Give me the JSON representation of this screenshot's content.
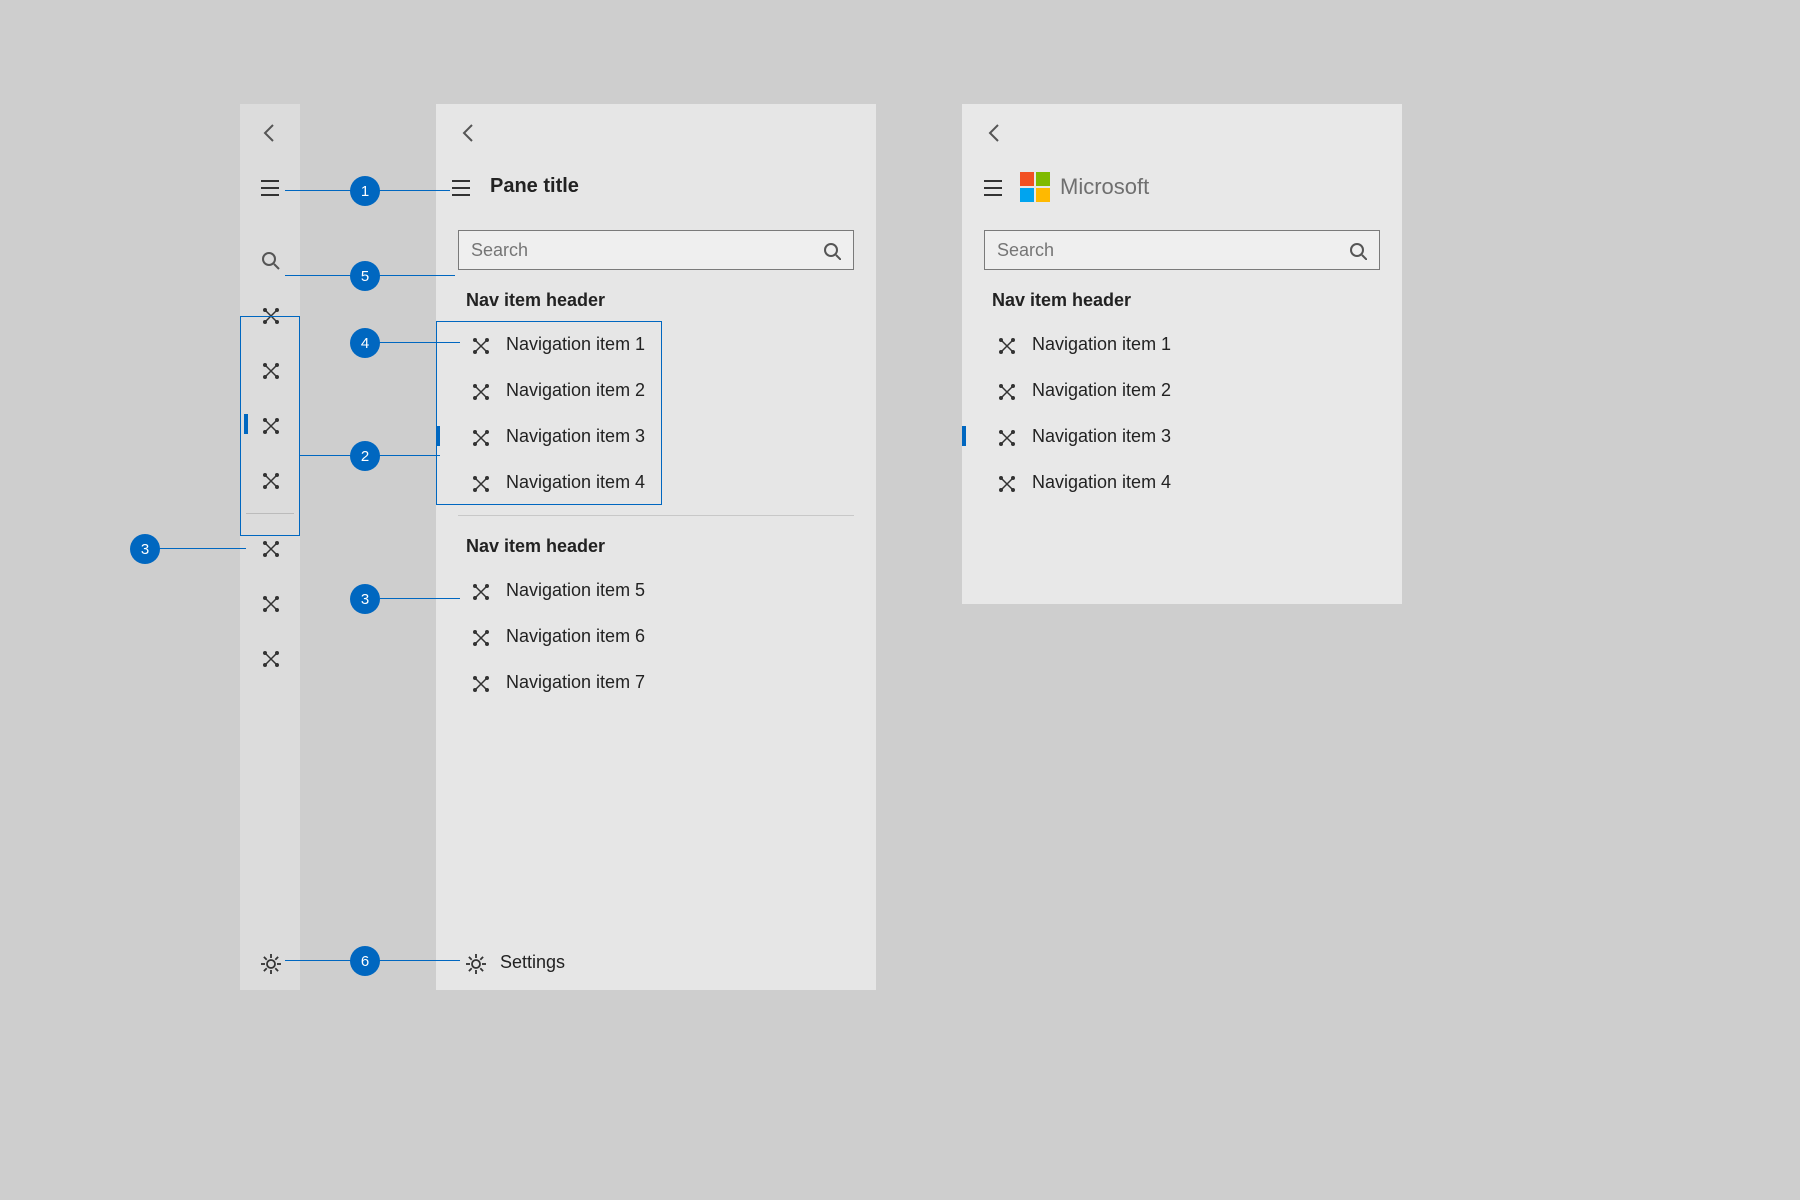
{
  "callouts": {
    "1": "1",
    "2": "2",
    "3": "3",
    "4": "4",
    "5": "5",
    "6": "6"
  },
  "rail": {
    "selected_index": 2
  },
  "pane": {
    "title": "Pane title",
    "search_placeholder": "Search",
    "group1_header": "Nav item header",
    "group1_items": [
      {
        "label": "Navigation item 1",
        "selected": false
      },
      {
        "label": "Navigation item 2",
        "selected": false
      },
      {
        "label": "Navigation item 3",
        "selected": true
      },
      {
        "label": "Navigation item 4",
        "selected": false
      }
    ],
    "group2_header": "Nav item header",
    "group2_items": [
      {
        "label": "Navigation item 5"
      },
      {
        "label": "Navigation item 6"
      },
      {
        "label": "Navigation item 7"
      }
    ],
    "settings_label": "Settings"
  },
  "pane3": {
    "brand": "Microsoft",
    "logo_colors": [
      "#f25022",
      "#7fba00",
      "#00a4ef",
      "#ffb900"
    ],
    "search_placeholder": "Search",
    "group_header": "Nav item header",
    "items": [
      {
        "label": "Navigation item 1",
        "selected": false
      },
      {
        "label": "Navigation item 2",
        "selected": false
      },
      {
        "label": "Navigation item 3",
        "selected": true
      },
      {
        "label": "Navigation item 4",
        "selected": false
      }
    ]
  }
}
